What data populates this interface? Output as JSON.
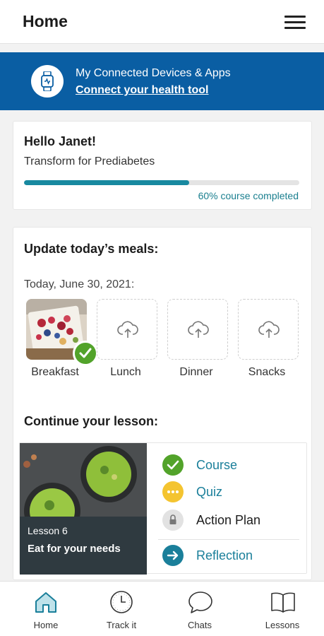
{
  "header": {
    "title": "Home",
    "menu_icon": "hamburger-menu-icon"
  },
  "banner": {
    "title": "My Connected Devices & Apps",
    "link": "Connect your health tool",
    "icon": "smartwatch-icon",
    "background": "#0a5ea3"
  },
  "greeting": {
    "hello": "Hello Janet!",
    "program": "Transform for Prediabetes",
    "progress_percent": 60,
    "progress_label": "60% course completed",
    "accent": "#1889a0"
  },
  "meals": {
    "title": "Update today’s meals:",
    "date": "Today, June 30, 2021:",
    "items": [
      {
        "label": "Breakfast",
        "status": "completed",
        "icon": "meal-photo"
      },
      {
        "label": "Lunch",
        "status": "empty",
        "icon": "cloud-upload-icon"
      },
      {
        "label": "Dinner",
        "status": "empty",
        "icon": "cloud-upload-icon"
      },
      {
        "label": "Snacks",
        "status": "empty",
        "icon": "cloud-upload-icon"
      }
    ]
  },
  "lesson": {
    "title": "Continue your lesson:",
    "number": "Lesson 6",
    "name": "Eat for your needs",
    "steps": [
      {
        "label": "Course",
        "status": "done",
        "icon": "check-circle-icon",
        "color": "#52a32a"
      },
      {
        "label": "Quiz",
        "status": "in-progress",
        "icon": "dots-circle-icon",
        "color": "#f4c430"
      },
      {
        "label": "Action Plan",
        "status": "locked",
        "icon": "lock-icon",
        "color": "#e2e2e2"
      },
      {
        "label": "Reflection",
        "status": "next",
        "icon": "arrow-circle-icon",
        "color": "#1a7f9a"
      }
    ]
  },
  "nav": {
    "items": [
      {
        "label": "Home",
        "icon": "house-icon",
        "active": true
      },
      {
        "label": "Track it",
        "icon": "clock-icon",
        "active": false
      },
      {
        "label": "Chats",
        "icon": "chat-bubble-icon",
        "active": false
      },
      {
        "label": "Lessons",
        "icon": "open-book-icon",
        "active": false
      }
    ],
    "active_color": "#1a7f9a"
  }
}
